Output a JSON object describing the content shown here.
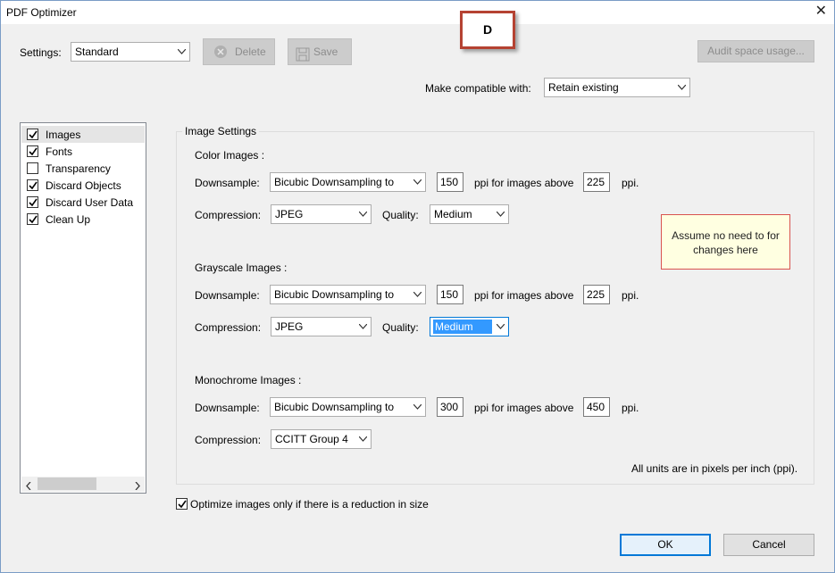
{
  "window": {
    "title": "PDF Optimizer"
  },
  "annotation": {
    "callout_label": "D",
    "note_text": "Assume no need to for changes here"
  },
  "toolbar": {
    "settings_label": "Settings:",
    "settings_value": "Standard",
    "delete_label": "Delete",
    "save_label": "Save",
    "audit_label": "Audit space usage...",
    "compat_label": "Make compatible with:",
    "compat_value": "Retain existing"
  },
  "panels": [
    {
      "label": "Images",
      "checked": true
    },
    {
      "label": "Fonts",
      "checked": true
    },
    {
      "label": "Transparency",
      "checked": false
    },
    {
      "label": "Discard Objects",
      "checked": true
    },
    {
      "label": "Discard User Data",
      "checked": true
    },
    {
      "label": "Clean Up",
      "checked": true
    }
  ],
  "image_settings": {
    "title": "Image Settings",
    "downsample_label": "Downsample:",
    "compression_label": "Compression:",
    "quality_label": "Quality:",
    "ppi_above_label": "ppi for images above",
    "ppi_label": "ppi.",
    "color": {
      "heading": "Color Images :",
      "downsample": "Bicubic Downsampling to",
      "ppi": "150",
      "above": "225",
      "compression": "JPEG",
      "quality": "Medium"
    },
    "grayscale": {
      "heading": "Grayscale Images :",
      "downsample": "Bicubic Downsampling to",
      "ppi": "150",
      "above": "225",
      "compression": "JPEG",
      "quality": "Medium"
    },
    "mono": {
      "heading": "Monochrome Images :",
      "downsample": "Bicubic Downsampling to",
      "ppi": "300",
      "above": "450",
      "compression": "CCITT Group 4"
    },
    "units_note": "All units are in pixels per inch (ppi)."
  },
  "optimize_only_label": "Optimize images only if there is a reduction in size",
  "ok_label": "OK",
  "cancel_label": "Cancel"
}
